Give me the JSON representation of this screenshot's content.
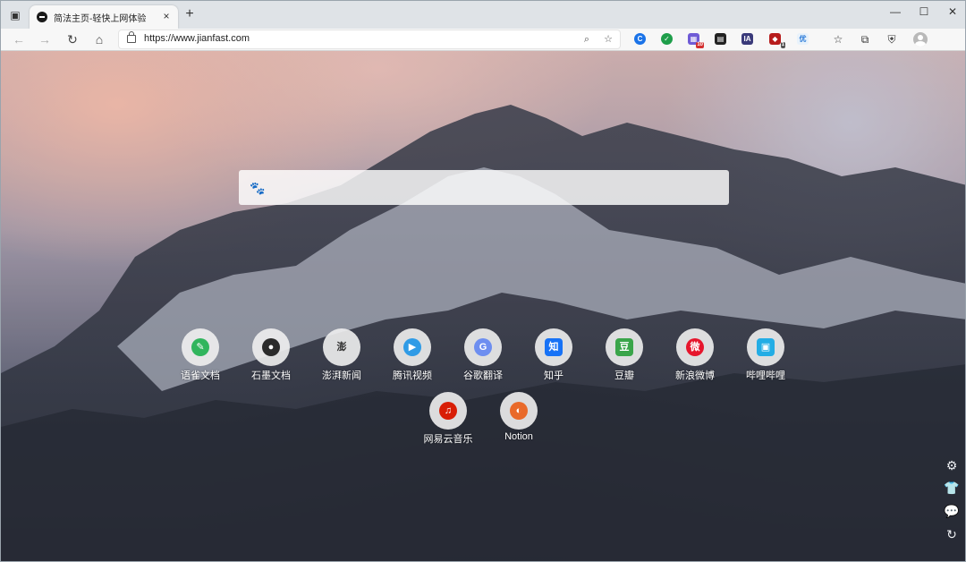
{
  "window": {
    "tab_title": "简法主页-轻快上网体验",
    "tab_close": "×",
    "new_tab": "+",
    "minimize": "—",
    "maximize": "☐",
    "close": "✕"
  },
  "toolbar": {
    "back": "←",
    "forward": "→",
    "refresh": "↻",
    "home": "⌂",
    "url": "https://www.jianfast.com",
    "extension_badge_1": "10",
    "extension_badge_2": "1",
    "ia_ext": "IA",
    "ext_text_1": "优",
    "icons": [
      "tab-actions-icon",
      "zoom-icon",
      "favorite-add-icon",
      "favorites-icon",
      "collections-icon",
      "browser-essentials-icon",
      "profile-icon"
    ]
  },
  "search": {
    "placeholder": ""
  },
  "shortcuts": [
    {
      "label": "语雀文档",
      "glyph": "✎",
      "color": "#31b55d"
    },
    {
      "label": "石墨文档",
      "glyph": "●",
      "color": "#2b2b2b"
    },
    {
      "label": "澎湃新闻",
      "glyph": "澎",
      "color": "#333333"
    },
    {
      "label": "腾讯视频",
      "glyph": "▶",
      "color": "#2f9be6"
    },
    {
      "label": "谷歌翻译",
      "glyph": "G",
      "color": "#6d8ef0"
    },
    {
      "label": "知乎",
      "glyph": "知",
      "color": "#1772f6"
    },
    {
      "label": "豆瓣",
      "glyph": "豆",
      "color": "#3aa54a"
    },
    {
      "label": "新浪微博",
      "glyph": "微",
      "color": "#e6162d"
    },
    {
      "label": "哔哩哔哩",
      "glyph": "▣",
      "color": "#23ade5"
    },
    {
      "label": "网易云音乐",
      "glyph": "♫",
      "color": "#d81e06"
    },
    {
      "label": "Notion",
      "glyph": "◐",
      "color": "#e96a2a"
    }
  ],
  "side_tools": {
    "settings": "⚙",
    "theme": "👕",
    "feedback": "💬",
    "refresh": "↻"
  }
}
